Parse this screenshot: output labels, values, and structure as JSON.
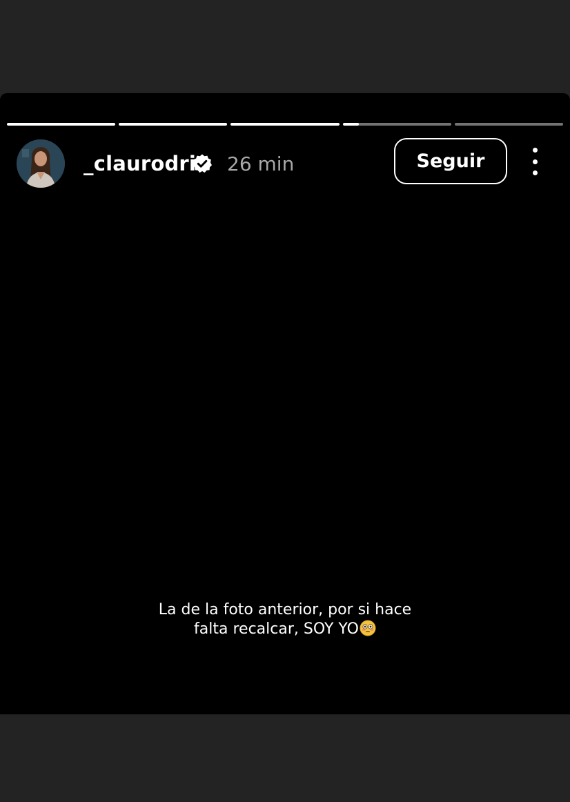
{
  "story": {
    "progress": [
      1,
      1,
      1,
      0.15,
      0
    ],
    "username": "_claurodri",
    "verified": true,
    "time": "26 min",
    "follow_label": "Seguir",
    "caption_line1": "La de la foto anterior, por si hace",
    "caption_line2": "falta recalcar, SOY YO",
    "caption_emoji": "flushed-face-emoji",
    "icons": {
      "verified": "verified-badge-icon",
      "more": "more-vertical-icon"
    },
    "colors": {
      "background": "#000000",
      "frame": "#232323",
      "verified": "#ffffff",
      "time": "#a8a8a8"
    }
  }
}
